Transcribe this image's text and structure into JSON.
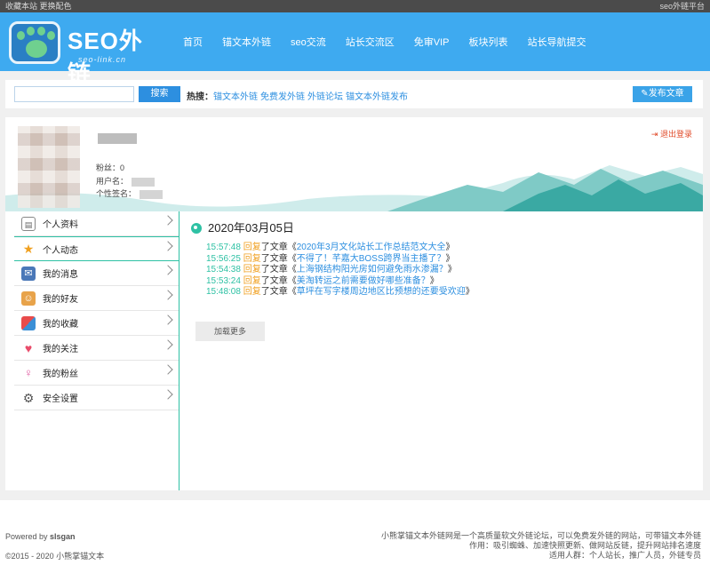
{
  "topbar": {
    "left_links": [
      "收藏本站",
      "更换配色"
    ],
    "right_text": "seo外链平台"
  },
  "logo": {
    "title": "SEO外链",
    "subtitle": "seo-link.cn"
  },
  "nav": [
    "首页",
    "锚文本外链",
    "seo交流",
    "站长交流区",
    "免审VIP",
    "板块列表",
    "站长导航提交"
  ],
  "search": {
    "placeholder": "",
    "button": "搜索",
    "hot_label": "热搜：",
    "hot_links": [
      "锚文本外链",
      "免费发外链",
      "外链论坛",
      "锚文本外链发布"
    ]
  },
  "publish_button": "发布文章",
  "profile": {
    "fans_label": "粉丝：",
    "fans_value": "0",
    "username_label": "用户名：",
    "signature_label": "个性签名：",
    "logout": "退出登录"
  },
  "menu": [
    {
      "label": "个人资料",
      "icon": "profile-card-icon"
    },
    {
      "label": "个人动态",
      "icon": "star-icon"
    },
    {
      "label": "我的消息",
      "icon": "message-icon"
    },
    {
      "label": "我的好友",
      "icon": "friends-icon"
    },
    {
      "label": "我的收藏",
      "icon": "favorites-box-icon"
    },
    {
      "label": "我的关注",
      "icon": "heart-icon"
    },
    {
      "label": "我的粉丝",
      "icon": "fans-icon"
    },
    {
      "label": "安全设置",
      "icon": "gear-icon"
    }
  ],
  "timeline": {
    "date": "2020年03月05日",
    "reply_word": "回复",
    "article_word": "了文章",
    "entries": [
      {
        "time": "15:57:48",
        "title": "2020年3月文化站长工作总结范文大全"
      },
      {
        "time": "15:56:25",
        "title": "不得了！芊嘉大BOSS跨界当主播了？"
      },
      {
        "time": "15:54:38",
        "title": "上海钢结构阳光房如何避免雨水渗漏？"
      },
      {
        "time": "15:53:24",
        "title": "美淘转运之前需要做好哪些准备？"
      },
      {
        "time": "15:48:08",
        "title": "草坪在写字楼周边地区比预想的还要受欢迎"
      }
    ],
    "load_more": "加载更多"
  },
  "footer": {
    "powered_label": "Powered by ",
    "powered_name": "slsgan",
    "copyright": "©2015 - 2020 小熊掌锚文本",
    "right_lines": [
      "小熊掌锚文本外链网是一个高质量软文外链论坛，可以免费发外链的网站，可带锚文本外链",
      "作用：吸引蜘蛛、加速快照更新、做网站反链，提升网站排名速度",
      "适用人群：个人站长，推广人员，外链专员"
    ]
  },
  "colors": {
    "header_blue": "#3eaaf0",
    "accent_teal": "#2ec1a4",
    "link_blue": "#2d8fe0",
    "reply_orange": "#f0a020",
    "logout_red": "#e04b2a"
  }
}
